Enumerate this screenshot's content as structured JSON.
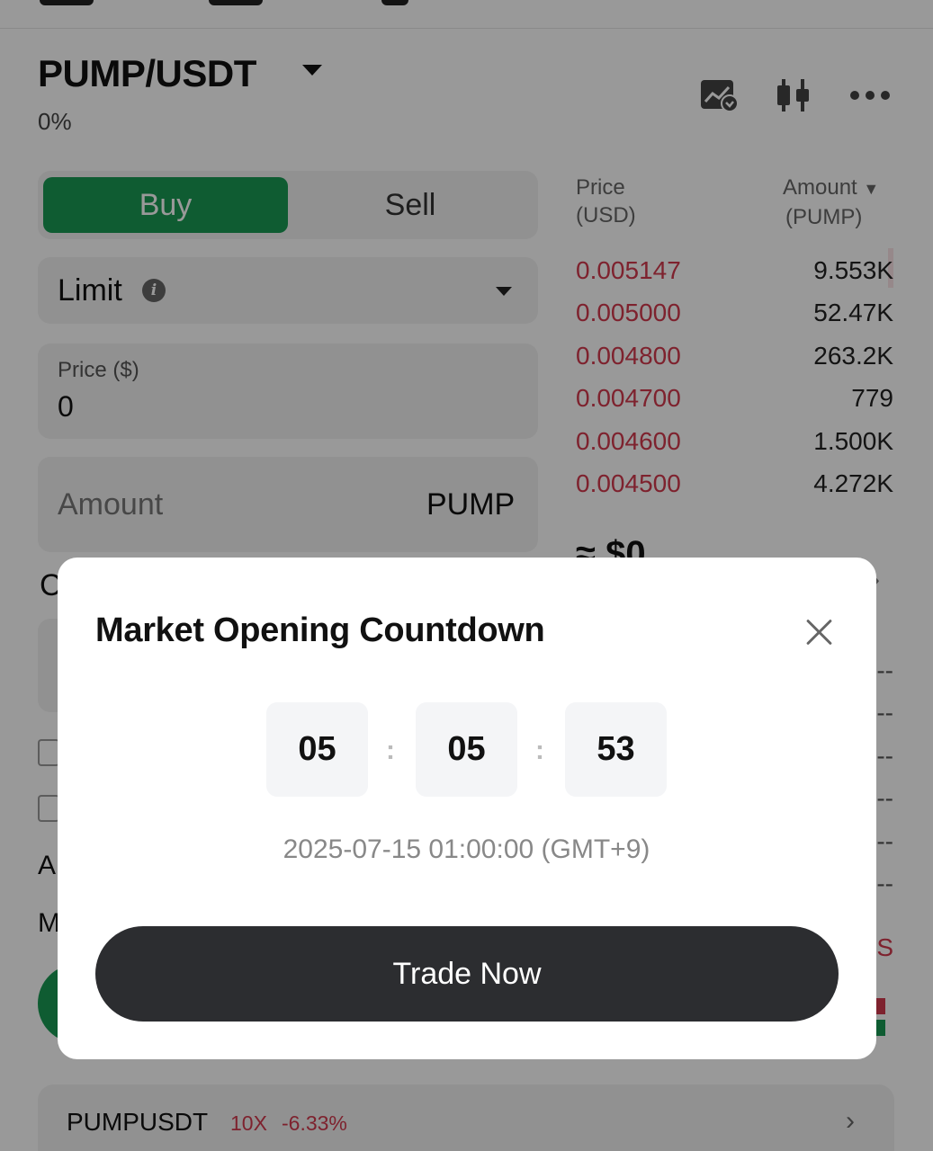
{
  "header": {
    "pair": "PUMP/USDT",
    "change": "0%"
  },
  "form": {
    "buy_label": "Buy",
    "sell_label": "Sell",
    "order_type": "Limit",
    "price_label": "Price ($)",
    "price_value": "0",
    "amount_placeholder": "Amount",
    "amount_unit": "PUMP"
  },
  "orderbook": {
    "price_header_line1": "Price",
    "price_header_line2": "(USD)",
    "amount_header_line1": "Amount",
    "amount_header_line2": "(PUMP)",
    "asks": [
      {
        "price": "0.005147",
        "amount": "9.553K"
      },
      {
        "price": "0.005000",
        "amount": "52.47K"
      },
      {
        "price": "0.004800",
        "amount": "263.2K"
      },
      {
        "price": "0.004700",
        "amount": "779"
      },
      {
        "price": "0.004600",
        "amount": "1.500K"
      },
      {
        "price": "0.004500",
        "amount": "4.272K"
      }
    ],
    "mid_price": "≈ $0",
    "colors": {
      "ask": "#d23a4e",
      "buy": "#1a9a54"
    }
  },
  "bottom": {
    "symbol": "PUMPUSDT",
    "leverage": "10X",
    "change": "-6.33%"
  },
  "modal": {
    "title": "Market Opening Countdown",
    "hours": "05",
    "minutes": "05",
    "seconds": "53",
    "separator": ":",
    "open_time": "2025-07-15 01:00:00 (GMT+9)",
    "cta": "Trade Now"
  },
  "icons": [
    "chart-alert-icon",
    "candlestick-icon",
    "more-icon",
    "info-icon",
    "close-icon",
    "chevron-right-icon"
  ]
}
